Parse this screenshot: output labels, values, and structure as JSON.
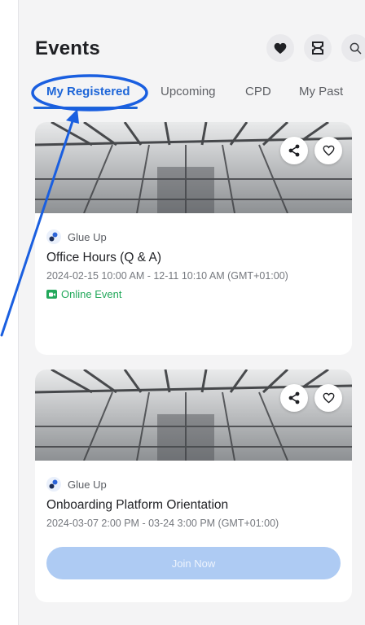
{
  "header": {
    "title": "Events",
    "actions": [
      {
        "icon": "heart-icon"
      },
      {
        "icon": "ticket-icon"
      },
      {
        "icon": "search-icon"
      }
    ]
  },
  "tabs": [
    {
      "label": "My Registered",
      "active": true
    },
    {
      "label": "Upcoming",
      "active": false
    },
    {
      "label": "CPD",
      "active": false
    },
    {
      "label": "My Past",
      "active": false
    }
  ],
  "events": [
    {
      "organizer": "Glue Up",
      "title": "Office Hours (Q & A)",
      "datetime": "2024-02-15 10:00 AM - 12-11 10:10 AM (GMT+01:00)",
      "type_label": "Online Event"
    },
    {
      "organizer": "Glue Up",
      "title": "Onboarding Platform Orientation",
      "datetime": "2024-03-07 2:00 PM - 03-24 3:00 PM (GMT+01:00)",
      "join_label": "Join Now"
    }
  ],
  "colors": {
    "accent": "#1e66d8",
    "online": "#22a85a",
    "join_disabled": "#aecbf3",
    "annotation": "#1a5fe0"
  }
}
